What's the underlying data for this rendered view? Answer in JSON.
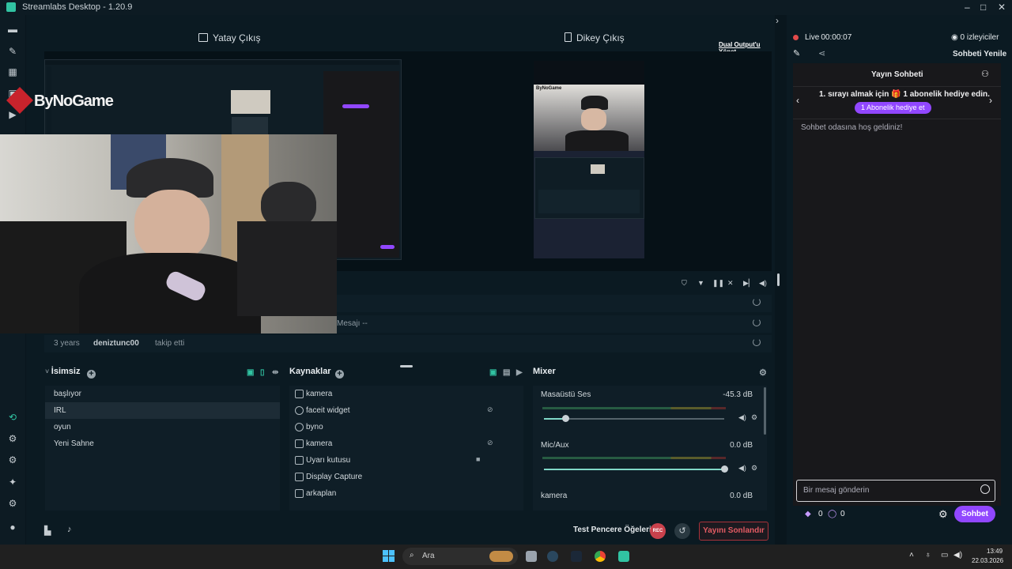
{
  "app": {
    "title": "Streamlabs Desktop - 1.20.9",
    "window_controls": [
      "–",
      "□",
      "✕"
    ]
  },
  "colors": {
    "accent": "#31c3a2",
    "twitch": "#9147ff",
    "danger": "#e35b63",
    "bg": "#09161d"
  },
  "nav_icons": [
    "editor-icon",
    "themes-icon",
    "store-icon",
    "collections-icon",
    "play-icon",
    "studio-mode-icon",
    "layout-icon",
    "settings-alt-icon",
    "sparkle-icon",
    "gear-icon",
    "user-icon"
  ],
  "outputs": {
    "horizontal": "Yatay Çıkış",
    "vertical": "Dikey Çıkış",
    "dual_link": "Dual Output'u Yönet"
  },
  "overlay_logo": "ByNoGame",
  "events": {
    "rows": [
      {
        "text": ""
      },
      {
        "text": "Mesajı --"
      },
      {
        "time": "3 years",
        "user": "deniztunc00",
        "action": "takip etti"
      }
    ]
  },
  "scenes": {
    "title": "İsimsiz",
    "items": [
      "başlıyor",
      "IRL",
      "oyun",
      "Yeni Sahne"
    ],
    "selected_index": 1
  },
  "sources": {
    "title": "Kaynaklar",
    "items": [
      {
        "label": "kamera",
        "icon": "webcam-icon",
        "hidden": false
      },
      {
        "label": "faceit widget",
        "icon": "globe-icon",
        "hidden": true
      },
      {
        "label": "byno",
        "icon": "globe-icon",
        "hidden": false
      },
      {
        "label": "kamera",
        "icon": "webcam-icon",
        "hidden": true
      },
      {
        "label": "Uyarı kutusu",
        "icon": "alert-icon",
        "locked": true
      },
      {
        "label": "Display Capture",
        "icon": "monitor-icon",
        "hidden": false
      },
      {
        "label": "arkaplan",
        "icon": "image-icon",
        "hidden": false
      }
    ]
  },
  "mixer": {
    "title": "Mixer",
    "channels": [
      {
        "name": "Masaüstü Ses",
        "db": "-45.3 dB",
        "volume": 0.12
      },
      {
        "name": "Mic/Aux",
        "db": "0.0 dB",
        "volume": 1.0
      },
      {
        "name": "kamera",
        "db": "0.0 dB",
        "volume": 1.0
      }
    ]
  },
  "footer": {
    "test_label": "Test Pencere Öğeleri",
    "rec": "REC",
    "end_stream": "Yayını Sonlandır"
  },
  "live": {
    "status": "Live",
    "time": "00:00:07",
    "viewers": "0 izleyiciler",
    "refresh_chat": "Sohbeti Yenile"
  },
  "chat": {
    "header": "Yayın Sohbeti",
    "promo_line": "1. sırayı almak için 🎁 1 abonelik hediye edin.",
    "gift_button": "1 Abonelik hediye et",
    "welcome": "Sohbet odasına hoş geldiniz!",
    "input_placeholder": "Bir mesaj gönderin",
    "bits": "0",
    "points": "0",
    "send": "Sohbet"
  },
  "taskbar": {
    "search_placeholder": "Ara",
    "time": "13:49",
    "date": "22.03.2026"
  }
}
